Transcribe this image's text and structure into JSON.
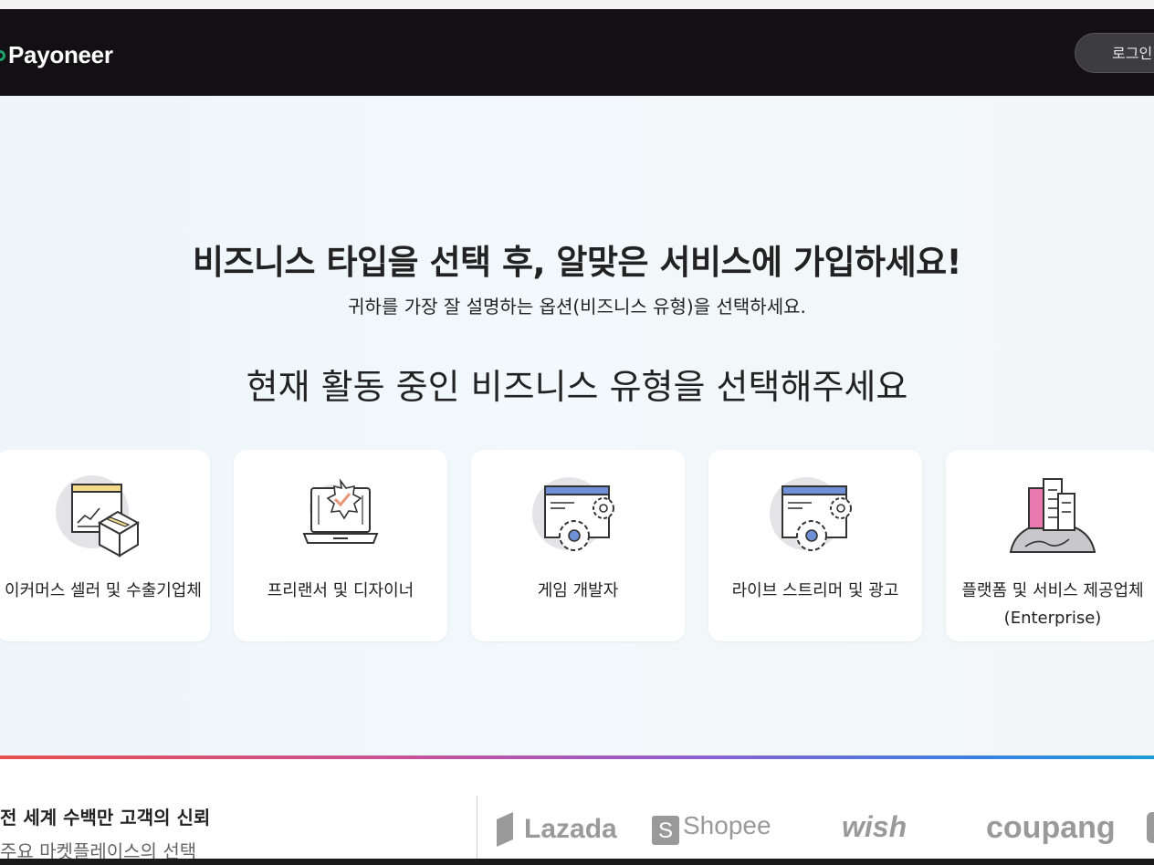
{
  "header": {
    "logo_text": "Payoneer",
    "login_label": "로그인"
  },
  "hero": {
    "title": "비즈니스 타입을 선택 후, 알맞은 서비스에 가입하세요!",
    "subtitle": "귀하를 가장 잘 설명하는 옵션(비즈니스 유형)을 선택하세요.",
    "question": "현재 활동 중인 비즈니스 유형을 선택해주세요"
  },
  "cards": [
    {
      "label": "이커머스 셀러 및 수출기업체",
      "icon": "ecommerce-box-icon"
    },
    {
      "label": "프리랜서 및 디자이너",
      "icon": "laptop-badge-icon"
    },
    {
      "label": "게임 개발자",
      "icon": "window-gears-icon"
    },
    {
      "label": "라이브 스트리머 및 광고",
      "icon": "window-gears-icon"
    },
    {
      "label": "플랫폼 및 서비스 제공업체(Enterprise)",
      "icon": "city-globe-icon"
    }
  ],
  "footer": {
    "trust_title": "전 세계 수백만 고객의 신뢰",
    "trust_sub": "주요 마켓플레이스의 선택",
    "brands": [
      "Lazada",
      "Shopee",
      "wish",
      "coupang"
    ]
  },
  "colors": {
    "header_bg": "#121012",
    "logo_accent": "#1ba36a",
    "card_accent_blue": "#6f8fd6",
    "card_accent_yellow": "#f3d98a",
    "card_accent_pink": "#e97ab0"
  }
}
